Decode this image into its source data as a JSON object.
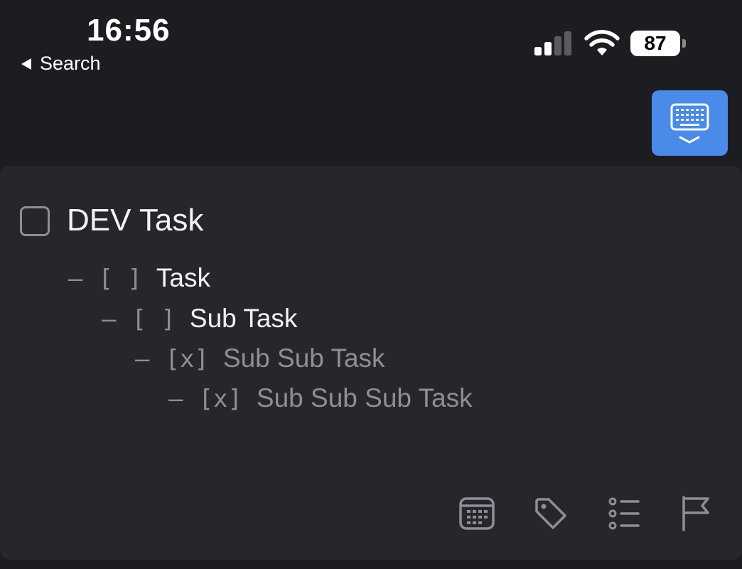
{
  "status_bar": {
    "time": "16:56",
    "back_label": "Search",
    "battery_level": "87"
  },
  "keyboard_button": {
    "icon": "keyboard-dismiss-icon",
    "color": "#4a8bea"
  },
  "task": {
    "title": "DEV Task",
    "checked": false,
    "notes": [
      {
        "dash": "–",
        "box": "[ ]",
        "text": "Task",
        "done": false
      },
      {
        "dash": "–",
        "box": "[ ]",
        "text": "Sub Task",
        "done": false
      },
      {
        "dash": "–",
        "box": "[x]",
        "text": "Sub Sub Task",
        "done": true
      },
      {
        "dash": "–",
        "box": "[x]",
        "text": "Sub Sub Sub Task",
        "done": true
      }
    ]
  },
  "toolbar": {
    "icons": [
      "calendar-icon",
      "tag-icon",
      "checklist-icon",
      "flag-icon"
    ]
  },
  "colors": {
    "background": "#1c1d21",
    "card": "#25272d",
    "accent": "#4a8bea",
    "muted": "#8e8f96"
  }
}
